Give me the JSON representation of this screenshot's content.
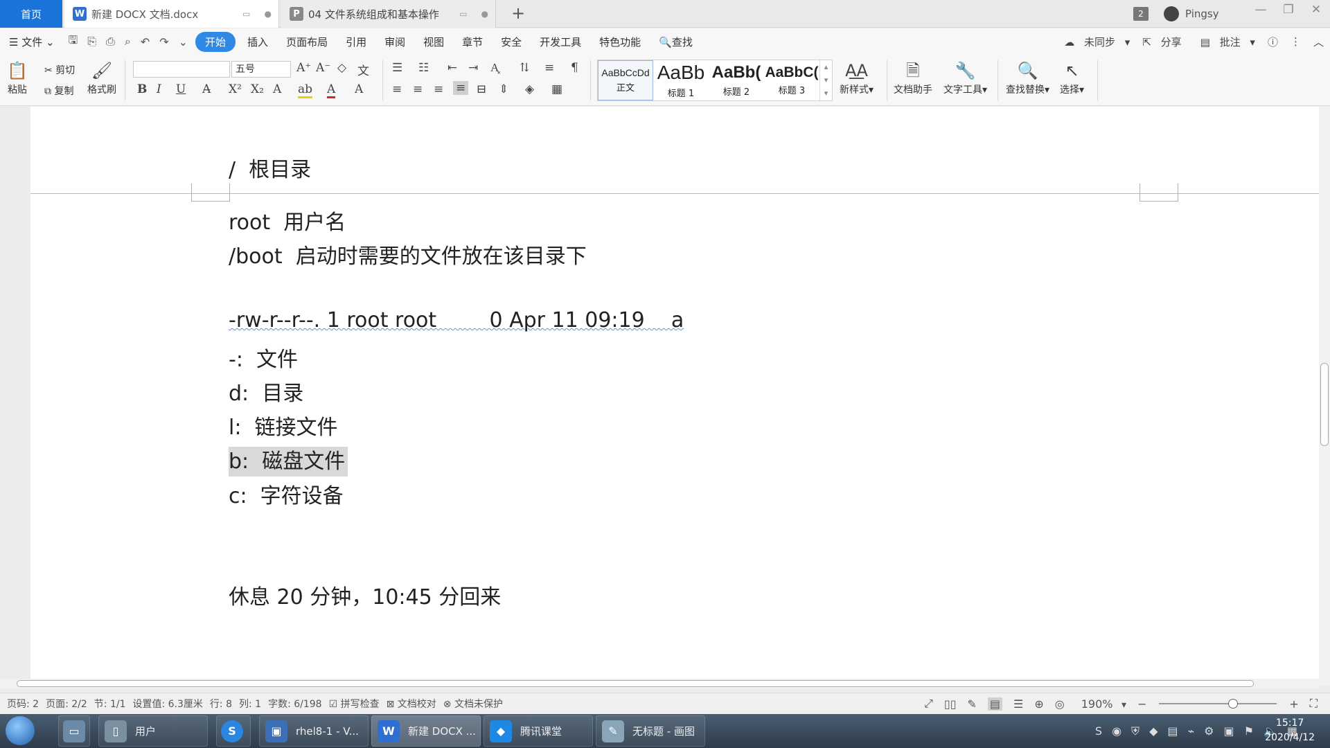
{
  "tabs": {
    "home": "首页",
    "doc1": "新建 DOCX 文档.docx",
    "doc2": "04 文件系统组成和基本操作"
  },
  "account": {
    "badge": "2",
    "name": "Pingsy"
  },
  "menu": {
    "file": "文件",
    "items": [
      "开始",
      "插入",
      "页面布局",
      "引用",
      "审阅",
      "视图",
      "章节",
      "安全",
      "开发工具",
      "特色功能"
    ],
    "search": "查找",
    "sync": "未同步",
    "share": "分享",
    "comment": "批注"
  },
  "ribbon": {
    "paste": "粘贴",
    "cut": "剪切",
    "copy": "复制",
    "format_painter": "格式刷",
    "font_name": "",
    "font_size": "五号",
    "styles": [
      {
        "preview": "AaBbCcDd",
        "caption": "正文"
      },
      {
        "preview": "AaBb",
        "caption": "标题 1"
      },
      {
        "preview": "AaBb(",
        "caption": "标题 2"
      },
      {
        "preview": "AaBbC(",
        "caption": "标题 3"
      }
    ],
    "new_style": "新样式",
    "doc_assistant": "文档助手",
    "text_tools": "文字工具",
    "find_replace": "查找替换",
    "select": "选择"
  },
  "document": {
    "lines": [
      "/  根目录",
      "root  用户名",
      "/boot  启动时需要的文件放在该目录下",
      "-rw-r--r--. 1 root root        0 Apr 11 09:19    a",
      "-:  文件",
      "d:  目录",
      "l:  链接文件",
      "b:  磁盘文件",
      "c:  字符设备",
      "休息 20 分钟，10:45 分回来"
    ]
  },
  "status": {
    "page_code": "页码: 2",
    "pages": "页面: 2/2",
    "section": "节: 1/1",
    "setting": "设置值: 6.3厘米",
    "row": "行: 8",
    "col": "列: 1",
    "words": "字数: 6/198",
    "spell": "拼写检查",
    "proof": "文档校对",
    "protect": "文档未保护",
    "zoom": "190%"
  },
  "taskbar": {
    "items": [
      "用户",
      "rhel8-1 - V...",
      "新建 DOCX ...",
      "腾讯课堂",
      "无标题 - 画图"
    ],
    "time": "15:17",
    "date": "2020/4/12"
  },
  "colors": {
    "accent": "#2e8ae6",
    "home_tab": "#1a73d9",
    "highlight": "#d9d9d9"
  }
}
